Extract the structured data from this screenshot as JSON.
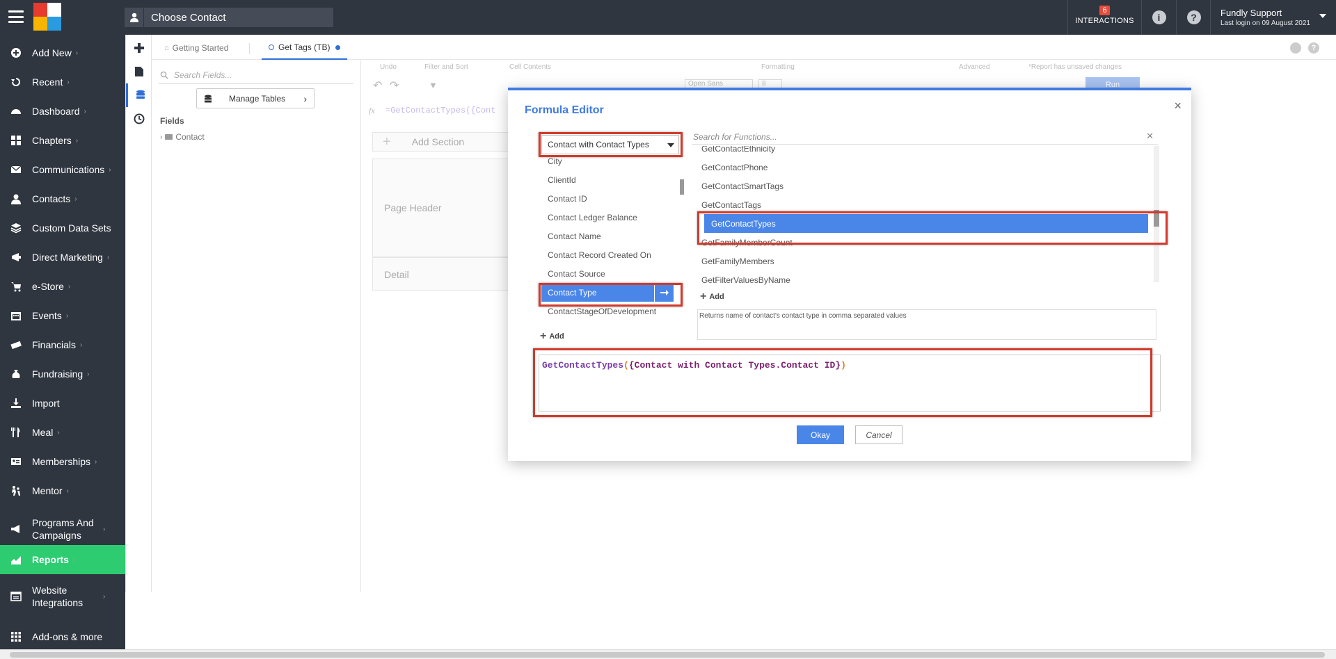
{
  "topbar": {
    "choose_contact": "Choose Contact",
    "interactions_count": "6",
    "interactions_label": "INTERACTIONS",
    "user_name": "Fundly Support",
    "last_login": "Last login on 09 August 2021"
  },
  "sidebar": {
    "items": [
      {
        "label": "Add New",
        "icon": "plus-circle-icon",
        "chevron": true
      },
      {
        "label": "Recent",
        "icon": "history-icon",
        "chevron": true
      },
      {
        "label": "Dashboard",
        "icon": "dashboard-icon",
        "chevron": true
      },
      {
        "label": "Chapters",
        "icon": "grid-icon",
        "chevron": true
      },
      {
        "label": "Communications",
        "icon": "envelope-icon",
        "chevron": true
      },
      {
        "label": "Contacts",
        "icon": "user-icon",
        "chevron": true
      },
      {
        "label": "Custom Data Sets",
        "icon": "layers-icon",
        "chevron": false
      },
      {
        "label": "Direct Marketing",
        "icon": "globe-icon",
        "chevron": true
      },
      {
        "label": "e-Store",
        "icon": "cart-icon",
        "chevron": true
      },
      {
        "label": "Events",
        "icon": "calendar-icon",
        "chevron": true
      },
      {
        "label": "Financials",
        "icon": "money-icon",
        "chevron": true
      },
      {
        "label": "Fundraising",
        "icon": "moneybag-icon",
        "chevron": true
      },
      {
        "label": "Import",
        "icon": "download-icon",
        "chevron": false
      },
      {
        "label": "Meal",
        "icon": "cutlery-icon",
        "chevron": true
      },
      {
        "label": "Memberships",
        "icon": "id-card-icon",
        "chevron": true
      },
      {
        "label": "Mentor",
        "icon": "mentor-icon",
        "chevron": true
      },
      {
        "label": "Programs And Campaigns",
        "icon": "megaphone-icon",
        "chevron": true
      },
      {
        "label": "Reports",
        "icon": "chart-area-icon",
        "chevron": true
      },
      {
        "label": "Website Integrations",
        "icon": "browser-icon",
        "chevron": true
      },
      {
        "label": "Add-ons & more",
        "icon": "apps-icon",
        "chevron": false
      }
    ]
  },
  "tabs": [
    {
      "label": "Getting Started"
    },
    {
      "label": "Get Tags (TB)"
    }
  ],
  "fields_panel": {
    "search_placeholder": "Search Fields...",
    "manage_tables": "Manage Tables",
    "title": "Fields",
    "tree_root": "Contact"
  },
  "ribbon": {
    "groups": [
      "Undo",
      "Filter and Sort",
      "Cell Contents",
      "Formatting",
      "Advanced",
      "*Report has unsaved changes"
    ],
    "font": "Open Sans",
    "size": "8",
    "run": "Run"
  },
  "formula_bar": "=GetContactTypes({Cont",
  "designer": {
    "add_section": "Add Section",
    "page_header": "Page Header",
    "detail": "Detail"
  },
  "modal": {
    "title": "Formula Editor",
    "close": "×",
    "table_select": "Contact with Contact Types",
    "fields": [
      "City",
      "ClientId",
      "Contact ID",
      "Contact Ledger Balance",
      "Contact Name",
      "Contact Record Created On",
      "Contact Source",
      "Contact Type",
      "ContactStageOfDevelopment"
    ],
    "selected_field": "Contact Type",
    "fields_add": "Add",
    "function_search_placeholder": "Search for Functions...",
    "functions": [
      "GetContactEthnicity",
      "GetContactPhone",
      "GetContactSmartTags",
      "GetContactTags",
      "GetContactTypes",
      "GetFamilyMemberCount",
      "GetFamilyMembers",
      "GetFilterValuesByName"
    ],
    "selected_function": "GetContactTypes",
    "functions_add": "Add",
    "function_description": "Returns name of contact's contact type in comma separated values",
    "formula": {
      "fn": "GetContactTypes",
      "open": "(",
      "ref": "{Contact with Contact Types.Contact ID}",
      "close": ")"
    },
    "okay": "Okay",
    "cancel": "Cancel"
  }
}
